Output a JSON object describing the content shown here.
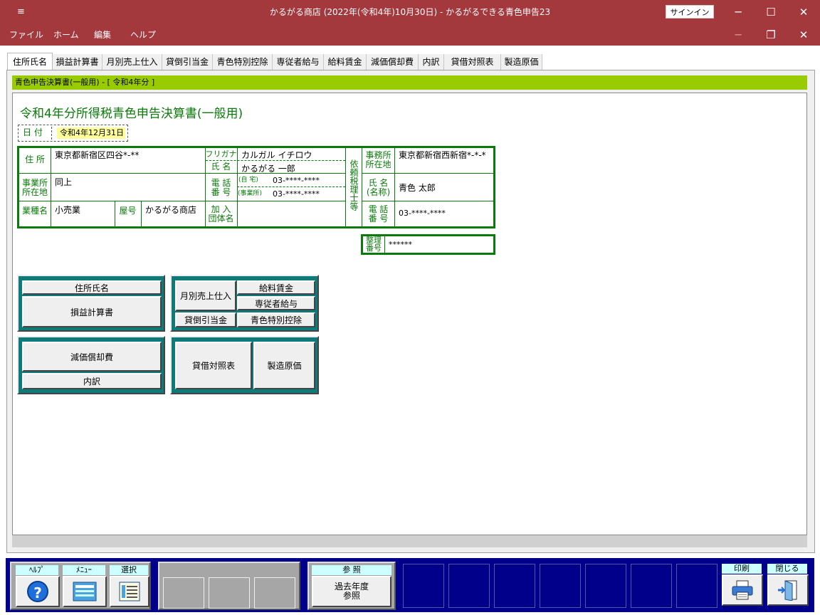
{
  "window": {
    "title": "かるがる商店 (2022年(令和4年)10月30日)  -  かるがるできる青色申告23",
    "signin": "サインイン",
    "menu_glyph": "≡",
    "min": "─",
    "max": "☐",
    "close": "✕"
  },
  "menubar": {
    "items": [
      "ファイル",
      "ホーム",
      "編集",
      "ヘルプ"
    ],
    "min": "─",
    "restore": "❐",
    "close": "✕"
  },
  "tabs": [
    "住所氏名",
    "損益計算書",
    "月別売上仕入",
    "貸倒引当金",
    "青色特別控除",
    "専従者給与",
    "給料賃金",
    "減価償却費",
    "内訳",
    "貸借対照表",
    "製造原価"
  ],
  "breadcrumb": "青色申告決算書(一般用) - [ 令和4年分 ]",
  "form": {
    "title": "令和4年分所得税青色申告決算書(一般用)",
    "date_label": "日 付",
    "date_value": "令和4年12月31日",
    "address_label": "住 所",
    "address_value": "東京都新宿区四谷*-**",
    "furigana_label": "フリガナ",
    "furigana_value": "カルガル イチロウ",
    "name_label": "氏 名",
    "name_value": "かるがる 一郎",
    "office_label_1": "事業所",
    "office_label_2": "所在地",
    "office_value": "同上",
    "phone_label_1": "電 話",
    "phone_label_2": "番 号",
    "home_label": "(自 宅)",
    "home_value": "03-****-****",
    "work_label": "(事業所)",
    "work_value": "03-****-****",
    "industry_label": "業種名",
    "industry_value": "小売業",
    "shop_label": "屋号",
    "shop_value": "かるがる商店",
    "group_label_1": "加 入",
    "group_label_2": "団体名",
    "group_value": "",
    "agent_label": "依頼税理士等",
    "agent_office_label_1": "事務所",
    "agent_office_label_2": "所在地",
    "agent_office_value": "東京都新宿西新宿*-*-*",
    "agent_name_label_1": "氏 名",
    "agent_name_label_2": "(名称)",
    "agent_name_value": "青色 太郎",
    "agent_phone_label_1": "電 話",
    "agent_phone_label_2": "番 号",
    "agent_phone_value": "03-****-****",
    "ref_label_1": "整理",
    "ref_label_2": "番号",
    "ref_value": "******"
  },
  "nav": {
    "address_name": "住所氏名",
    "pl": "損益計算書",
    "monthly": "月別売上仕入",
    "salary": "給料賃金",
    "family": "専従者給与",
    "bad_debt": "貸倒引当金",
    "blue_deduction": "青色特別控除",
    "depreciation": "減価償却費",
    "breakdown": "内訳",
    "balance_sheet": "貸借対照表",
    "manufacturing": "製造原価"
  },
  "bottom": {
    "help_label": "ﾍﾙﾌﾟ",
    "menu_label": "ﾒﾆｭｰ",
    "select_label": "選択",
    "ref_label": "参 照",
    "past_line1": "過去年度",
    "past_line2": "参照",
    "print_label": "印刷",
    "close_label": "閉じる",
    "help_glyph": "?"
  },
  "colors": {
    "titlebar": "#a3383d",
    "accent_green": "#0a7a0a",
    "teal": "#0e7a7a",
    "navy": "#00008b",
    "lime": "#99cc00"
  }
}
